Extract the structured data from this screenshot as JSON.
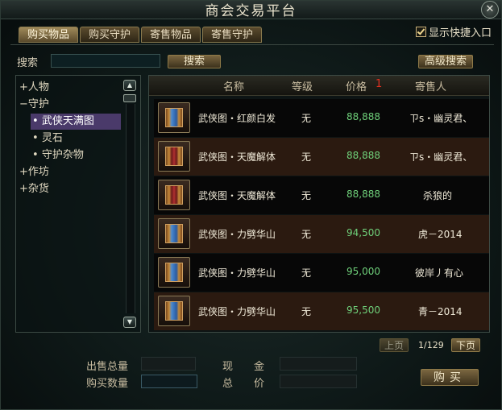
{
  "window": {
    "title": "商会交易平台",
    "close_icon": "close-icon"
  },
  "tabs": [
    {
      "label": "购买物品",
      "active": true
    },
    {
      "label": "购买守护",
      "active": false
    },
    {
      "label": "寄售物品",
      "active": false
    },
    {
      "label": "寄售守护",
      "active": false
    }
  ],
  "quick_entry": {
    "label": "显示快捷入口",
    "checked": true
  },
  "search": {
    "label": "搜索",
    "value": "",
    "button": "搜索",
    "advanced_button": "高级搜索"
  },
  "tree": [
    {
      "label": "人物",
      "prefix": "+"
    },
    {
      "label": "守护",
      "prefix": "−"
    },
    {
      "label": "武侠天满图",
      "prefix": "•",
      "selected": true
    },
    {
      "label": "灵石",
      "prefix": "•"
    },
    {
      "label": "守护杂物",
      "prefix": "•"
    },
    {
      "label": "作坊",
      "prefix": "+"
    },
    {
      "label": "杂货",
      "prefix": "+"
    }
  ],
  "table": {
    "headers": {
      "name": "名称",
      "level": "等级",
      "price": "价格",
      "price_sort": "1",
      "seller": "寄售人"
    },
    "rows": [
      {
        "name": "武侠图・红颜白发",
        "level": "无",
        "price": "88,888",
        "seller": "ㄗs・幽灵君、",
        "icon": "scroll-blue-icon"
      },
      {
        "name": "武侠图・天魔解体",
        "level": "无",
        "price": "88,888",
        "seller": "ㄗs・幽灵君、",
        "icon": "scroll-red-icon"
      },
      {
        "name": "武侠图・天魔解体",
        "level": "无",
        "price": "88,888",
        "seller": "杀狼的",
        "icon": "scroll-red-icon"
      },
      {
        "name": "武侠图・力劈华山",
        "level": "无",
        "price": "94,500",
        "seller": "虎－2014",
        "icon": "scroll-blue-icon"
      },
      {
        "name": "武侠图・力劈华山",
        "level": "无",
        "price": "95,000",
        "seller": "彼岸丿有心",
        "icon": "scroll-blue-icon"
      },
      {
        "name": "武侠图・力劈华山",
        "level": "无",
        "price": "95,500",
        "seller": "青－2014",
        "icon": "scroll-blue-icon"
      }
    ]
  },
  "pager": {
    "prev": "上页",
    "next": "下页",
    "page": "1/129"
  },
  "footer": {
    "sell_total_label": "出售总量",
    "buy_qty_label": "购买数量",
    "cash_label": "现　　金",
    "total_price_label": "总　　价",
    "buy_button": "购买"
  },
  "colors": {
    "price": "#6fd07a",
    "selected": "#4a3a6a",
    "accent_sort": "#e03020"
  }
}
